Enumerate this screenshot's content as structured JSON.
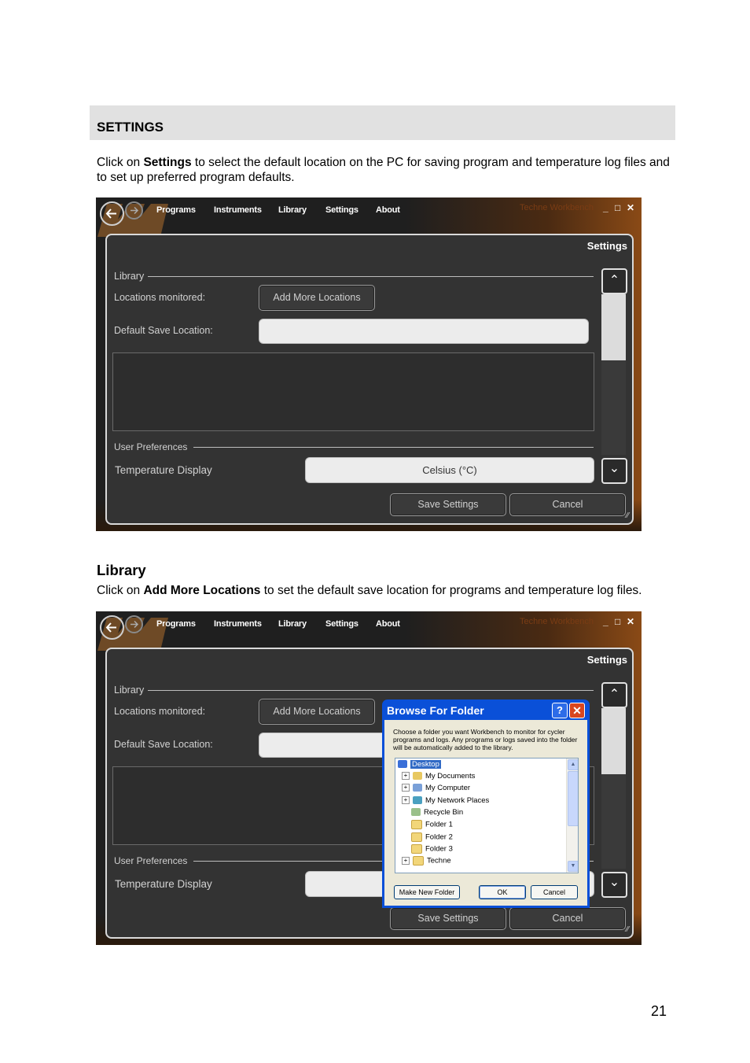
{
  "section": {
    "title": "SETTINGS"
  },
  "intro": {
    "pre": "Click on ",
    "bold": "Settings",
    "post": " to select the default location on the PC for saving program and temperature log files and to set up preferred program defaults."
  },
  "library_section": {
    "heading": "Library",
    "pre": "Click on ",
    "bold": "Add More Locations",
    "post": " to set the default save location for programs and temperature log files."
  },
  "app": {
    "nav": [
      "Programs",
      "Instruments",
      "Library",
      "Settings",
      "About"
    ],
    "brand": "Techne Workbench",
    "window_controls": {
      "min": "_",
      "max": "□",
      "close": "✕"
    },
    "panel_title": "Settings",
    "library_group": "Library",
    "locations_label": "Locations monitored:",
    "add_locations_button": "Add More Locations",
    "default_save_label": "Default Save Location:",
    "user_prefs_group": "User Preferences",
    "temp_display_label": "Temperature Display",
    "temp_display_value": "Celsius (°C)",
    "save_button": "Save Settings",
    "cancel_button": "Cancel"
  },
  "dialog": {
    "title": "Browse For Folder",
    "help": "?",
    "close": "✕",
    "description": "Choose a folder you want Workbench to monitor for cycler programs and logs. Any programs or logs saved into the folder will be automatically added to the library.",
    "tree": [
      "Desktop",
      "My Documents",
      "My Computer",
      "My Network Places",
      "Recycle Bin",
      "Folder 1",
      "Folder 2",
      "Folder 3",
      "Techne"
    ],
    "make_new_folder": "Make New Folder",
    "ok": "OK",
    "cancel": "Cancel"
  },
  "page_number": "21"
}
